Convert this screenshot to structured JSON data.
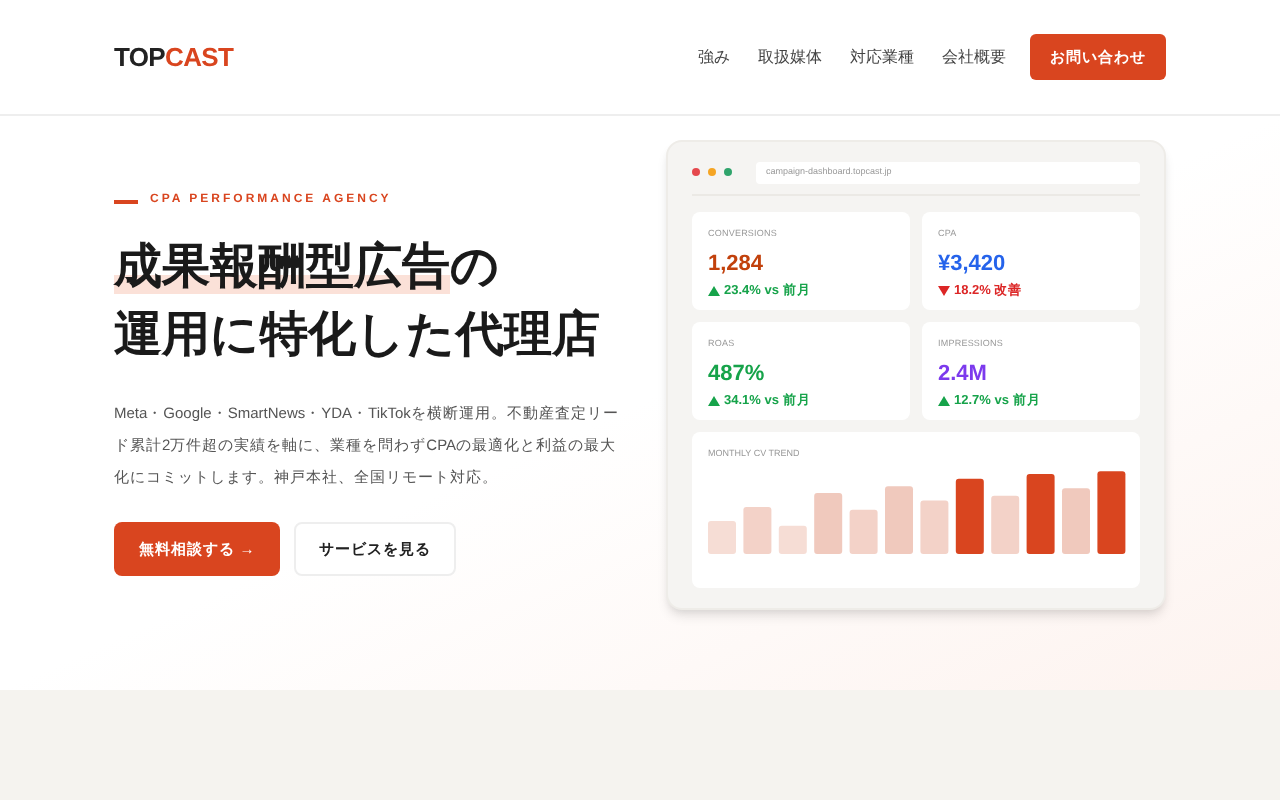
{
  "header": {
    "logo_dark": "TOP",
    "logo_accent": "CAST",
    "nav": [
      "強み",
      "取扱媒体",
      "対応業種",
      "会社概要"
    ],
    "cta": "お問い合わせ"
  },
  "hero": {
    "eyebrow": "CPA PERFORMANCE AGENCY",
    "title_highlight": "成果報酬型広告",
    "title_rest": "の",
    "title_line2": "運用に特化した代理店",
    "description": "Meta・Google・SmartNews・YDA・TikTokを横断運用。不動産査定リード累計2万件超の実績を軸に、業種を問わずCPAの最適化と利益の最大化にコミットします。神戸本社、全国リモート対応。",
    "primary_button": "無料相談する →",
    "secondary_button": "サービスを見る"
  },
  "dashboard": {
    "url": "campaign-dashboard.topcast.jp",
    "metrics": [
      {
        "label": "CONVERSIONS",
        "value": "1,284",
        "delta": "23.4% vs 前月",
        "kind": "up",
        "color": "#c2410c"
      },
      {
        "label": "CPA",
        "value": "¥3,420",
        "delta": "18.2% 改善",
        "kind": "down",
        "color": "#2563eb"
      },
      {
        "label": "ROAS",
        "value": "487%",
        "delta": "34.1% vs 前月",
        "kind": "up",
        "color": "#16a34a"
      },
      {
        "label": "IMPRESSIONS",
        "value": "2.4M",
        "delta": "12.7% vs 前月",
        "kind": "up",
        "color": "#7c3aed"
      }
    ],
    "trend_title": "MONTHLY CV TREND"
  }
}
